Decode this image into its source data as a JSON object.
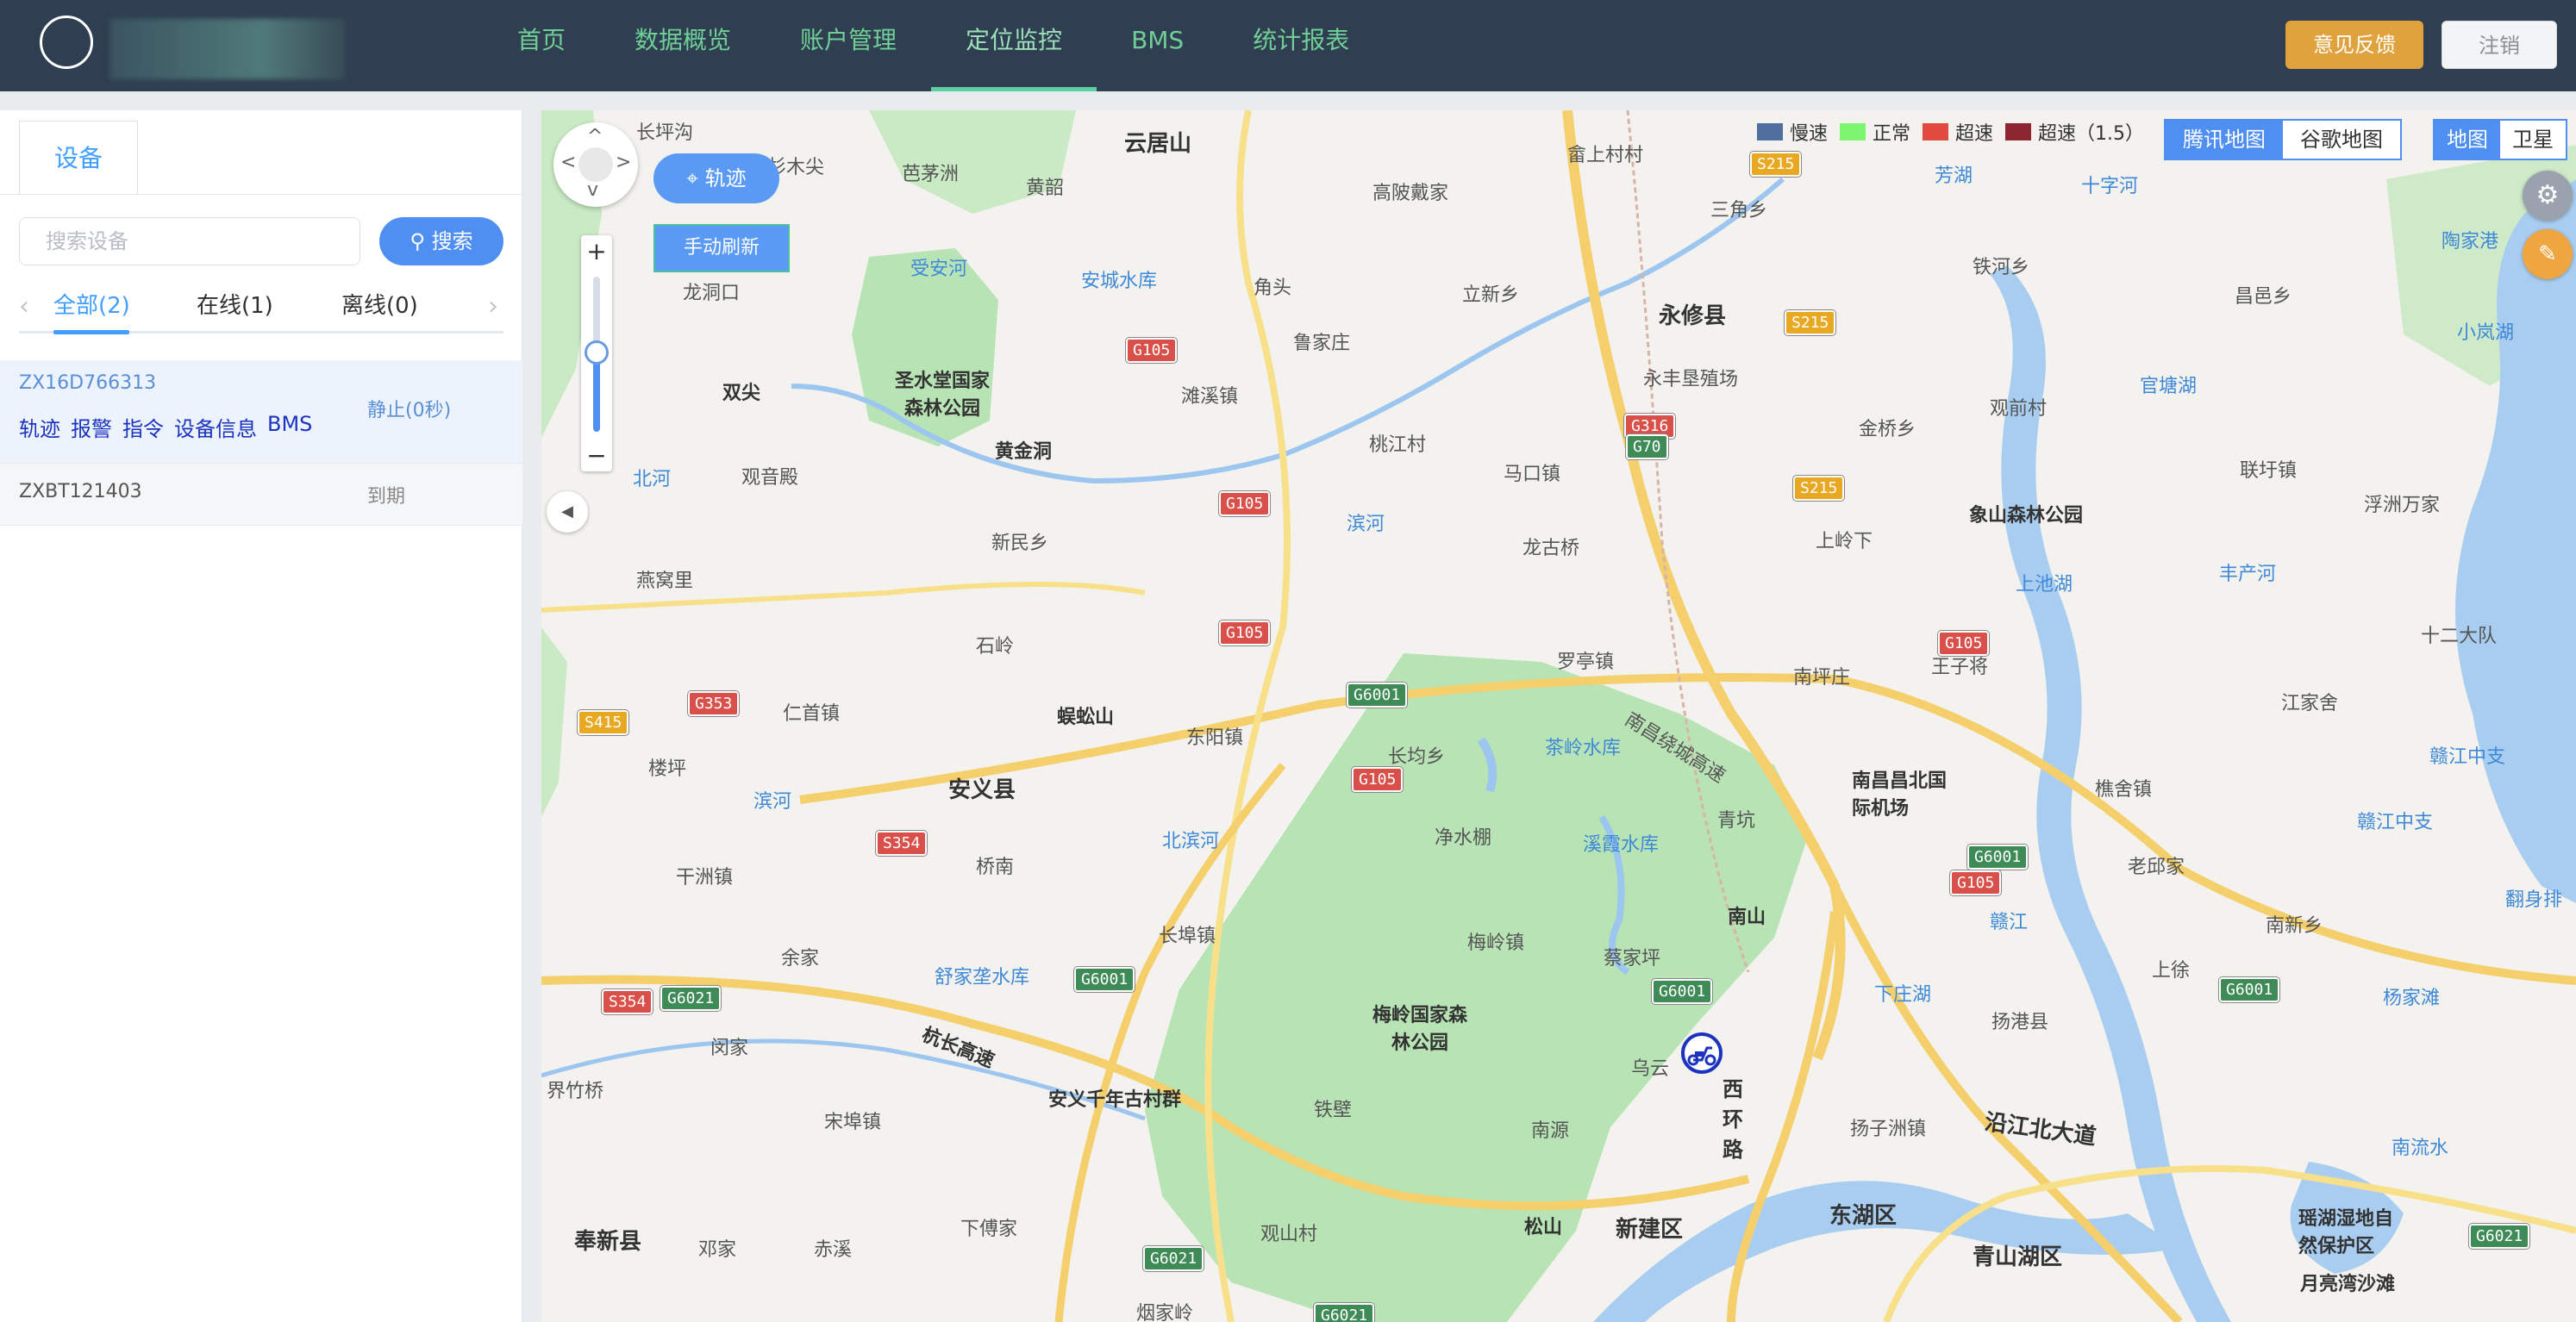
{
  "nav": {
    "items": [
      "首页",
      "数据概览",
      "账户管理",
      "定位监控",
      "BMS",
      "统计报表"
    ],
    "active_index": 3
  },
  "header": {
    "feedback_label": "意见反馈",
    "logout_label": "注销"
  },
  "sidebar": {
    "tab_label": "设备",
    "search": {
      "placeholder": "搜索设备",
      "button_label": "搜索"
    },
    "filters": {
      "all": "全部(2)",
      "online": "在线(1)",
      "offline": "离线(0)"
    },
    "devices": [
      {
        "id": "ZX16D766313",
        "status": "静止(0秒)",
        "actions": [
          "轨迹",
          "报警",
          "指令",
          "设备信息",
          "BMS"
        ]
      },
      {
        "id": "ZXBT121403",
        "status": "到期"
      }
    ]
  },
  "map": {
    "track_button": "轨迹",
    "refresh_button": "手动刷新",
    "legend": [
      {
        "label": "慢速",
        "color": "#4f6fa0"
      },
      {
        "label": "正常",
        "color": "#7ef56f"
      },
      {
        "label": "超速",
        "color": "#e04a3f"
      },
      {
        "label": "超速（1.5）",
        "color": "#8c2530"
      }
    ],
    "providers": [
      "腾讯地图",
      "谷歌地图"
    ],
    "active_provider": "腾讯地图",
    "view_types": [
      "地图",
      "卫星"
    ],
    "active_view": "地图",
    "labels": {
      "l1": "长坪沟",
      "l2": "杉木尖",
      "l3": "芭茅洲",
      "l4": "黄韶",
      "l5": "云居山",
      "l6": "高陂戴家",
      "l7": "畲上村村",
      "l8": "三角乡",
      "l9": "芳湖",
      "l10": "十字河",
      "l11": "受安河",
      "l12": "安城水库",
      "l13": "角头",
      "l14": "立新乡",
      "l15": "永修县",
      "l16": "铁河乡",
      "l17": "昌邑乡",
      "l18": "陶家港",
      "l19": "小岚湖",
      "l20": "龙洞口",
      "l21": "圣水堂国家森林公园",
      "l22": "滩溪镇",
      "l23": "鲁家庄",
      "l24": "永丰垦殖场",
      "l25": "官塘湖",
      "l26": "双尖",
      "l27": "黄金洞",
      "l28": "金桥乡",
      "l29": "观前村",
      "l30": "北河",
      "l31": "观音殿",
      "l32": "桃江村",
      "l33": "马口镇",
      "l34": "联圩镇",
      "l35": "象山森林公园",
      "l36": "浮洲万家",
      "l37": "新民乡",
      "l38": "滨河",
      "l39": "龙古桥",
      "l40": "上岭下",
      "l41": "燕窝里",
      "l42": "上池湖",
      "l43": "丰产河",
      "l44": "石岭",
      "l45": "罗亭镇",
      "l46": "南坪庄",
      "l47": "王子将",
      "l48": "十二大队",
      "l49": "仁首镇",
      "l50": "蜈蚣山",
      "l51": "东阳镇",
      "l52": "长均乡",
      "l53": "茶岭水库",
      "l54": "南昌绕城高速",
      "l55": "江家舍",
      "l56": "安义县",
      "l57": "楼坪",
      "l58": "滨河",
      "l59": "南昌昌北国际机场",
      "l60": "樵舍镇",
      "l61": "赣江中支",
      "l62": "净水棚",
      "l63": "溪霞水库",
      "l64": "青坑",
      "l65": "干洲镇",
      "l66": "桥南",
      "l67": "北滨河",
      "l68": "老邱家",
      "l69": "赣江中支",
      "l70": "翻身排",
      "l71": "南山",
      "l72": "余家",
      "l73": "长埠镇",
      "l74": "梅岭镇",
      "l75": "蔡家坪",
      "l76": "赣江",
      "l77": "南新乡",
      "l78": "舒家垄水库",
      "l79": "梅岭国家森林公园",
      "l80": "上徐",
      "l81": "杨家滩",
      "l82": "闵家",
      "l83": "杭长高速",
      "l84": "下庄湖",
      "l85": "扬港县",
      "l86": "乌云",
      "l87": "界竹桥",
      "l88": "安义千年古村群",
      "l89": "西环路",
      "l90": "宋埠镇",
      "l91": "铁壁",
      "l92": "南源",
      "l93": "扬子洲镇",
      "l94": "沿江北大道",
      "l95": "南流水",
      "l96": "东湖区",
      "l97": "瑶湖湿地自然保护区",
      "l98": "松山",
      "l99": "新建区",
      "l100": "奉新县",
      "l101": "邓家",
      "l102": "赤溪",
      "l103": "下傅家",
      "l104": "观山村",
      "l105": "青山湖区",
      "l106": "月亮湾沙滩",
      "l107": "烟家岭"
    },
    "shields": {
      "s1": "S215",
      "s2": "G105",
      "s3": "S215",
      "s4": "G316",
      "s5": "G70",
      "s6": "S215",
      "s7": "G105",
      "s8": "G105",
      "s9": "G105",
      "s10": "G6001",
      "s11": "G353",
      "s12": "S415",
      "s13": "G105",
      "s14": "S354",
      "s15": "G6001",
      "s16": "G105",
      "s17": "G6001",
      "s18": "G6001",
      "s19": "G6001",
      "s20": "G6021",
      "s21": "S354",
      "s22": "G6021",
      "s23": "G6021",
      "s24": "G6021"
    }
  }
}
